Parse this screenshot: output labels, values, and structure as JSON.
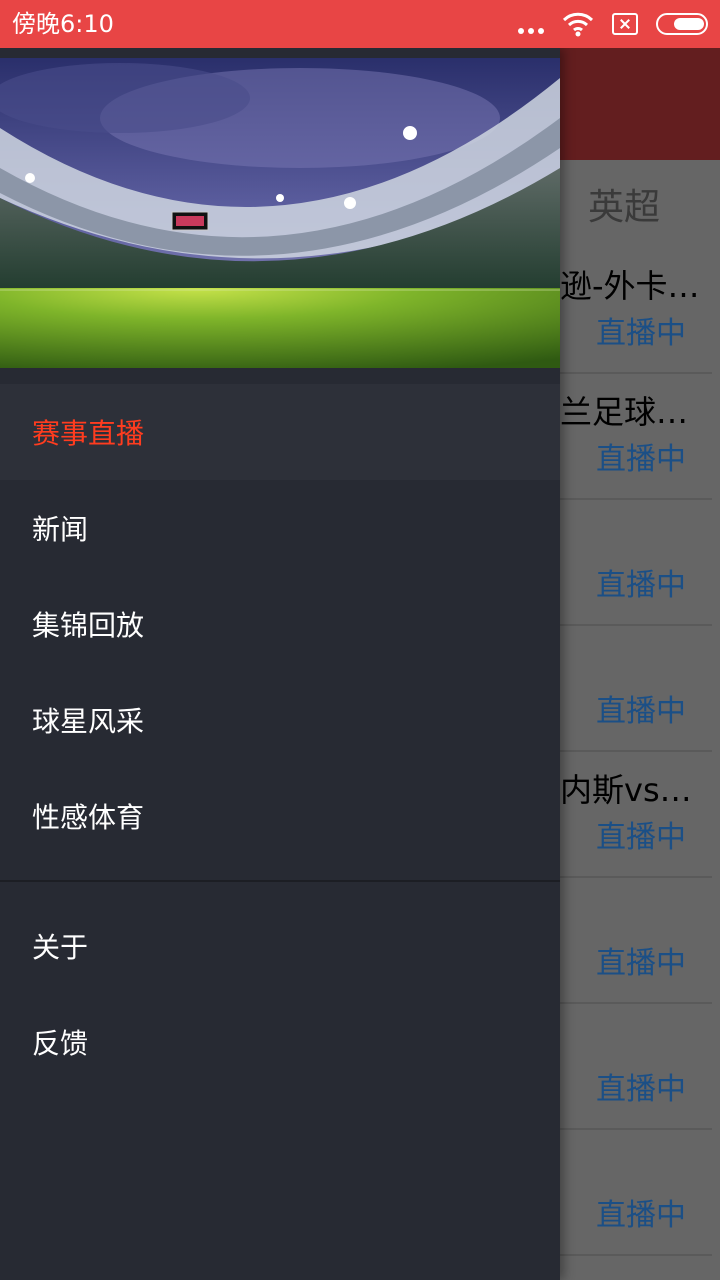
{
  "status_bar": {
    "time": "傍晚6:10",
    "icons": [
      "more-dots-icon",
      "wifi-icon",
      "no-sim-icon",
      "battery-icon"
    ]
  },
  "background_app": {
    "tab_label": "英超",
    "matches": [
      {
        "title": "逊-外卡…",
        "status": "直播中"
      },
      {
        "title": "兰足球超…",
        "status": "直播中"
      },
      {
        "title": "",
        "status": "直播中"
      },
      {
        "title": "",
        "status": "直播中"
      },
      {
        "title": "内斯vs巴…",
        "status": "直播中"
      },
      {
        "title": "",
        "status": "直播中"
      },
      {
        "title": "",
        "status": "直播中"
      },
      {
        "title": "",
        "status": "直播中"
      }
    ]
  },
  "drawer": {
    "header_image": "stadium-image",
    "menu": [
      {
        "label": "赛事直播",
        "active": true
      },
      {
        "label": "新闻",
        "active": false
      },
      {
        "label": "集锦回放",
        "active": false
      },
      {
        "label": "球星风采",
        "active": false
      },
      {
        "label": "性感体育",
        "active": false
      }
    ],
    "secondary_menu": [
      {
        "label": "关于"
      },
      {
        "label": "反馈"
      }
    ]
  },
  "colors": {
    "status_bar": "#e84545",
    "toolbar": "#631e1f",
    "drawer_bg": "#272a33",
    "active_item": "#ff3c1f",
    "live_status": "#1b4f86"
  }
}
